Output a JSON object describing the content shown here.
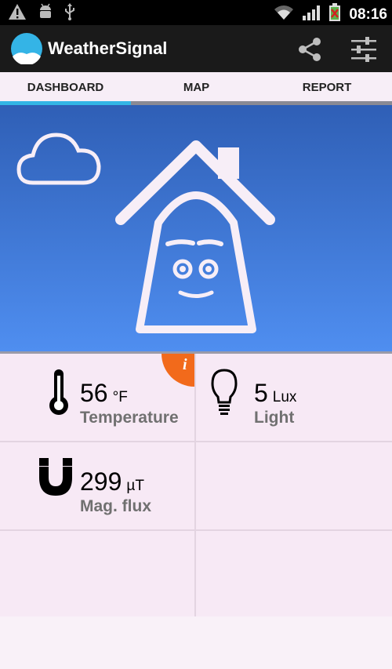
{
  "status_bar": {
    "time": "08:16",
    "icons": [
      "warning-icon",
      "android-debug-icon",
      "usb-icon",
      "wifi-icon",
      "signal-icon",
      "battery-icon"
    ]
  },
  "app_bar": {
    "title": "WeatherSignal",
    "actions": [
      "share-icon",
      "settings-sliders-icon"
    ]
  },
  "tabs": [
    {
      "label": "DASHBOARD",
      "selected": true
    },
    {
      "label": "MAP",
      "selected": false
    },
    {
      "label": "REPORT",
      "selected": false
    }
  ],
  "hero": {
    "illustration": "house-face-icon",
    "weather_icon": "cloud-icon"
  },
  "sensors": [
    {
      "value": "56",
      "unit": "°F",
      "label": "Temperature",
      "icon": "thermometer-icon"
    },
    {
      "value": "5",
      "unit": "Lux",
      "label": "Light",
      "icon": "lightbulb-icon"
    },
    {
      "value": "299",
      "unit": "µT",
      "label": "Mag. flux",
      "icon": "magnet-icon"
    }
  ],
  "colors": {
    "accent": "#33b5e5",
    "tab_inactive_indicator": "#8a8a94",
    "info_badge": "#f26a1b",
    "label_gray": "#707070"
  }
}
